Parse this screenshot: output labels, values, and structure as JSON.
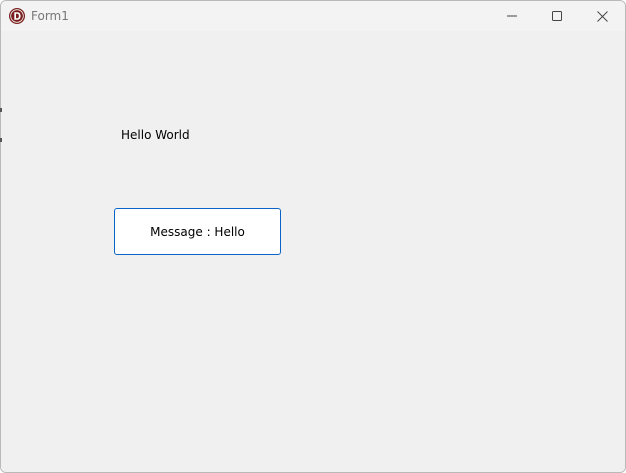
{
  "window": {
    "title": "Form1",
    "app_icon": "delphi-d-icon",
    "controls": {
      "minimize": "minimize-icon",
      "maximize": "maximize-icon",
      "close": "close-icon"
    }
  },
  "form": {
    "label_text": "Hello World",
    "button_label": "Message : Hello"
  },
  "colors": {
    "background": "#f0f0f0",
    "titlebar": "#f3f3f3",
    "button_border": "#0a64c8",
    "icon_red": "#7a1e1e"
  }
}
